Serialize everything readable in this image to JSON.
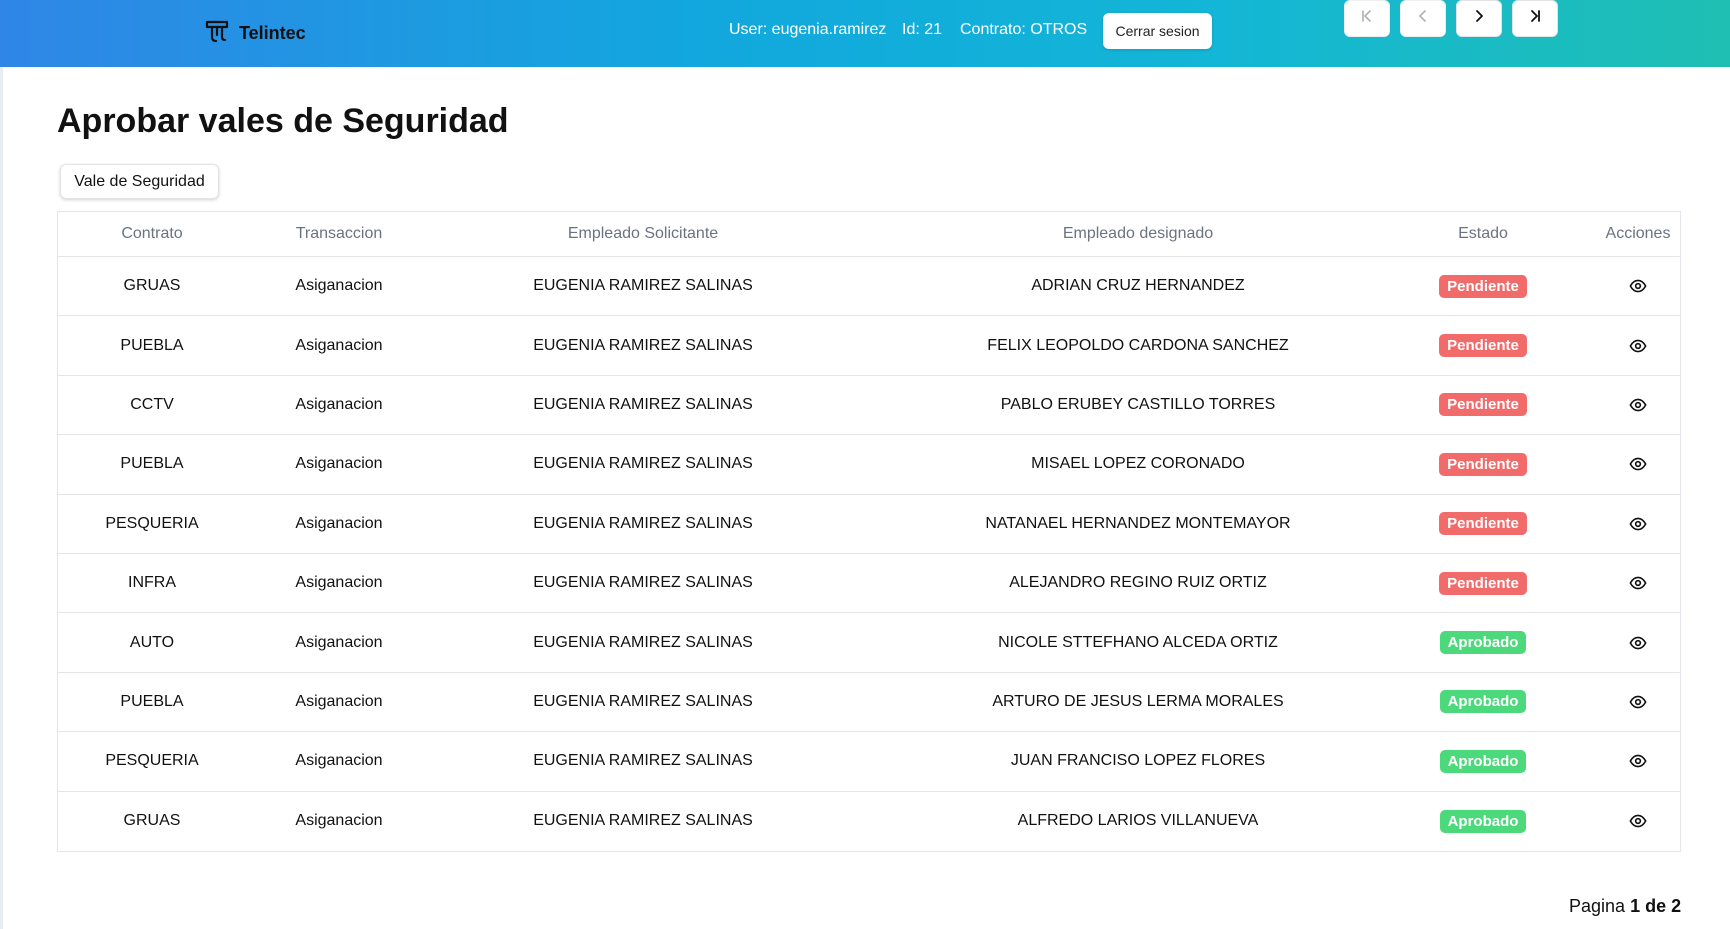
{
  "header": {
    "brand": "Telintec",
    "user_text": "User: eugenia.ramirez",
    "id_text": "Id: 21",
    "contrato_text": "Contrato: OTROS",
    "logout_label": "Cerrar sesion"
  },
  "page": {
    "title": "Aprobar vales de Seguridad",
    "vale_button": "Vale de Seguridad"
  },
  "table": {
    "columns": [
      "Contrato",
      "Transaccion",
      "Empleado Solicitante",
      "Empleado designado",
      "Estado",
      "Acciones"
    ],
    "rows": [
      {
        "contrato": "GRUAS",
        "transaccion": "Asiganacion",
        "solicitante": "EUGENIA RAMIREZ SALINAS",
        "designado": "ADRIAN CRUZ HERNANDEZ",
        "estado": "Pendiente"
      },
      {
        "contrato": "PUEBLA",
        "transaccion": "Asiganacion",
        "solicitante": "EUGENIA RAMIREZ SALINAS",
        "designado": "FELIX LEOPOLDO CARDONA SANCHEZ",
        "estado": "Pendiente"
      },
      {
        "contrato": "CCTV",
        "transaccion": "Asiganacion",
        "solicitante": "EUGENIA RAMIREZ SALINAS",
        "designado": "PABLO ERUBEY CASTILLO TORRES",
        "estado": "Pendiente"
      },
      {
        "contrato": "PUEBLA",
        "transaccion": "Asiganacion",
        "solicitante": "EUGENIA RAMIREZ SALINAS",
        "designado": "MISAEL LOPEZ CORONADO",
        "estado": "Pendiente"
      },
      {
        "contrato": "PESQUERIA",
        "transaccion": "Asiganacion",
        "solicitante": "EUGENIA RAMIREZ SALINAS",
        "designado": "NATANAEL HERNANDEZ MONTEMAYOR",
        "estado": "Pendiente"
      },
      {
        "contrato": "INFRA",
        "transaccion": "Asiganacion",
        "solicitante": "EUGENIA RAMIREZ SALINAS",
        "designado": "ALEJANDRO REGINO RUIZ ORTIZ",
        "estado": "Pendiente"
      },
      {
        "contrato": "AUTO",
        "transaccion": "Asiganacion",
        "solicitante": "EUGENIA RAMIREZ SALINAS",
        "designado": "NICOLE STTEFHANO ALCEDA ORTIZ",
        "estado": "Aprobado"
      },
      {
        "contrato": "PUEBLA",
        "transaccion": "Asiganacion",
        "solicitante": "EUGENIA RAMIREZ SALINAS",
        "designado": "ARTURO DE JESUS LERMA MORALES",
        "estado": "Aprobado"
      },
      {
        "contrato": "PESQUERIA",
        "transaccion": "Asiganacion",
        "solicitante": "EUGENIA RAMIREZ SALINAS",
        "designado": "JUAN FRANCISO LOPEZ FLORES",
        "estado": "Aprobado"
      },
      {
        "contrato": "GRUAS",
        "transaccion": "Asiganacion",
        "solicitante": "EUGENIA RAMIREZ SALINAS",
        "designado": "ALFREDO LARIOS VILLANUEVA",
        "estado": "Aprobado"
      }
    ],
    "action_icon": "eye-icon"
  },
  "status_colors": {
    "Pendiente": "#f26b6b",
    "Aprobado": "#4cd97b"
  },
  "pagination": {
    "label": "Pagina",
    "current": "1",
    "separator": "de",
    "total": "2",
    "icons": [
      "first-page-icon",
      "prev-page-icon",
      "next-page-icon",
      "last-page-icon"
    ]
  }
}
